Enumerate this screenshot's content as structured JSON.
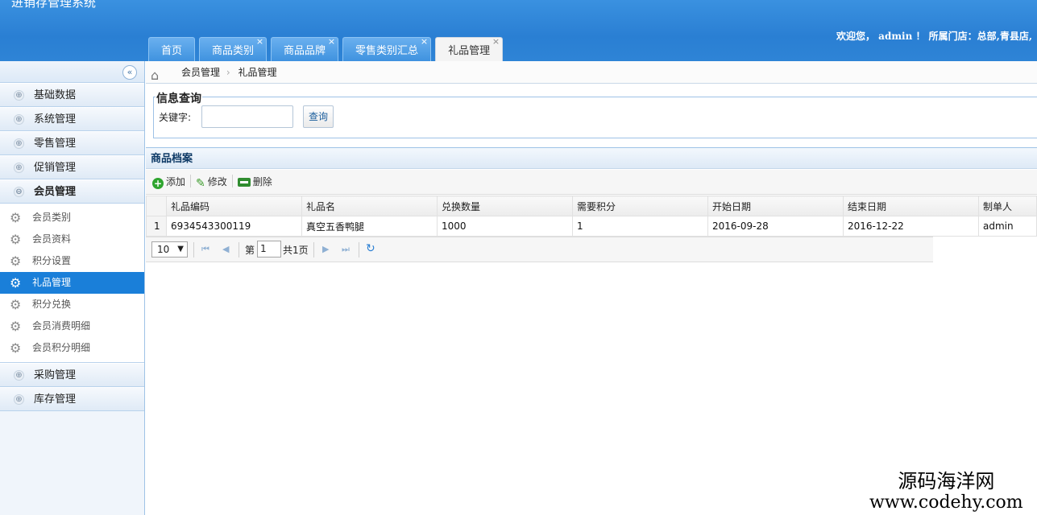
{
  "app": {
    "title": "进销存管理系统",
    "welcome": "欢迎您， admin ！ 所属门店：总部,青县店,"
  },
  "tabs": [
    {
      "label": "首页",
      "closable": false,
      "active": false
    },
    {
      "label": "商品类别",
      "closable": true,
      "active": false
    },
    {
      "label": "商品品牌",
      "closable": true,
      "active": false
    },
    {
      "label": "零售类别汇总",
      "closable": true,
      "active": false
    },
    {
      "label": "礼品管理",
      "closable": true,
      "active": true
    }
  ],
  "sidebar": {
    "collapse_icon": "«",
    "groups": [
      {
        "label": "基础数据",
        "icon": "⊕"
      },
      {
        "label": "系统管理",
        "icon": "⊕"
      },
      {
        "label": "零售管理",
        "icon": "⊕"
      },
      {
        "label": "促销管理",
        "icon": "⊕"
      },
      {
        "label": "会员管理",
        "icon": "⊖"
      },
      {
        "label": "采购管理",
        "icon": "⊕"
      },
      {
        "label": "库存管理",
        "icon": "⊕"
      }
    ],
    "member_items": [
      {
        "label": "会员类别",
        "active": false
      },
      {
        "label": "会员资料",
        "active": false
      },
      {
        "label": "积分设置",
        "active": false
      },
      {
        "label": "礼品管理",
        "active": true
      },
      {
        "label": "积分兑换",
        "active": false
      },
      {
        "label": "会员消费明细",
        "active": false
      },
      {
        "label": "会员积分明细",
        "active": false
      }
    ]
  },
  "breadcrumb": {
    "items": [
      "会员管理",
      "礼品管理"
    ]
  },
  "search": {
    "legend": "信息查询",
    "keyword_label": "关键字:",
    "keyword_value": "",
    "button": "查询"
  },
  "grid": {
    "title": "商品档案",
    "toolbar": {
      "add": "添加",
      "edit": "修改",
      "delete": "删除"
    },
    "columns": [
      "礼品编码",
      "礼品名",
      "兑换数量",
      "需要积分",
      "开始日期",
      "结束日期",
      "制单人"
    ],
    "rows": [
      {
        "rn": "1",
        "cells": [
          "6934543300119",
          "真空五香鸭腿",
          "1000",
          "1",
          "2016-09-28",
          "2016-12-22",
          "admin"
        ]
      }
    ]
  },
  "pager": {
    "page_size": "10",
    "page_prefix": "第",
    "page_value": "1",
    "page_total": "共1页"
  },
  "watermark": {
    "name": "源码海洋网",
    "url": "www.codehy.com"
  }
}
